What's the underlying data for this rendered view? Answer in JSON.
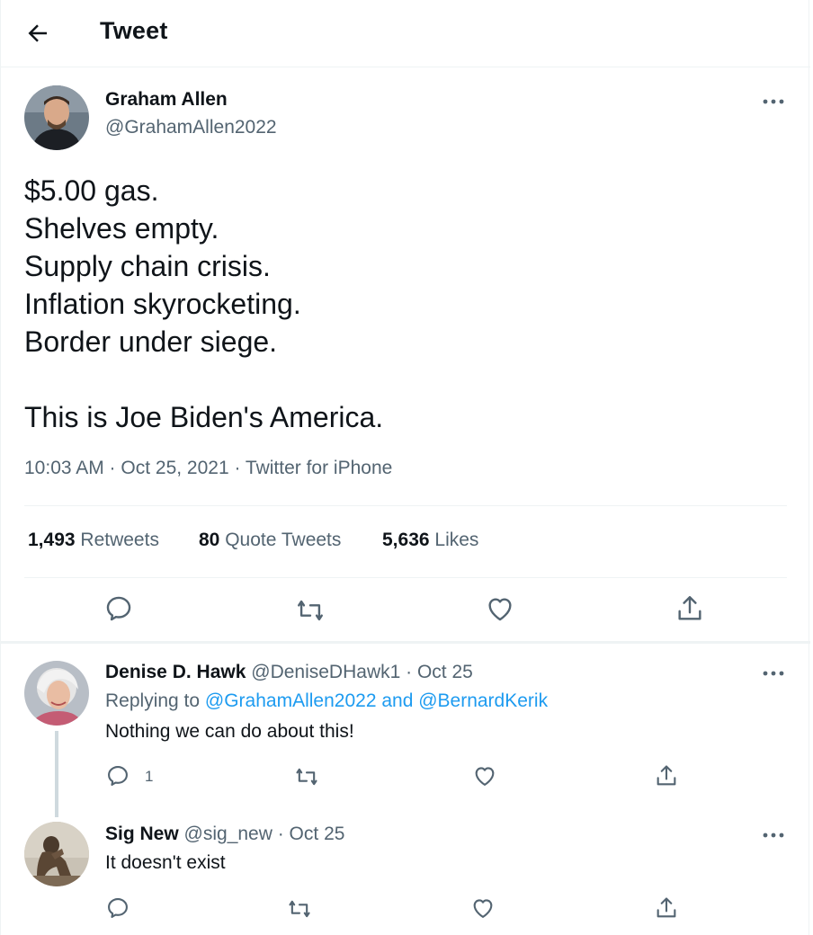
{
  "header": {
    "title": "Tweet",
    "back_icon": "arrow-left-icon"
  },
  "tweet": {
    "author_name": "Graham Allen",
    "author_handle": "@GrahamAllen2022",
    "text_lines": [
      "$5.00 gas.",
      "Shelves empty.",
      "Supply chain crisis.",
      "Inflation skyrocketing.",
      "Border under siege.",
      "",
      "This is Joe Biden's America."
    ],
    "meta": "10:03 AM · Oct 25, 2021 · Twitter for iPhone",
    "retweets_count": "1,493",
    "retweets_label": "Retweets",
    "quotes_count": "80",
    "quotes_label": "Quote Tweets",
    "likes_count": "5,636",
    "likes_label": "Likes",
    "icons": [
      "reply-icon",
      "retweet-icon",
      "like-icon",
      "share-icon",
      "more-icon"
    ]
  },
  "replies": [
    {
      "name": "Denise D. Hawk",
      "handle_date": "@DeniseDHawk1 · Oct 25",
      "replying_prefix": "Replying to",
      "replying_links": "@GrahamAllen2022 and @BernardKerik",
      "text": "Nothing we can do about this!",
      "reply_count": "1"
    },
    {
      "name": "Sig New",
      "handle_date": "@sig_new · Oct 25",
      "text": "It doesn't exist"
    }
  ],
  "colors": {
    "text": "#0f1419",
    "secondary": "#536471",
    "link": "#1d9bf0",
    "divider": "#eff3f4"
  }
}
